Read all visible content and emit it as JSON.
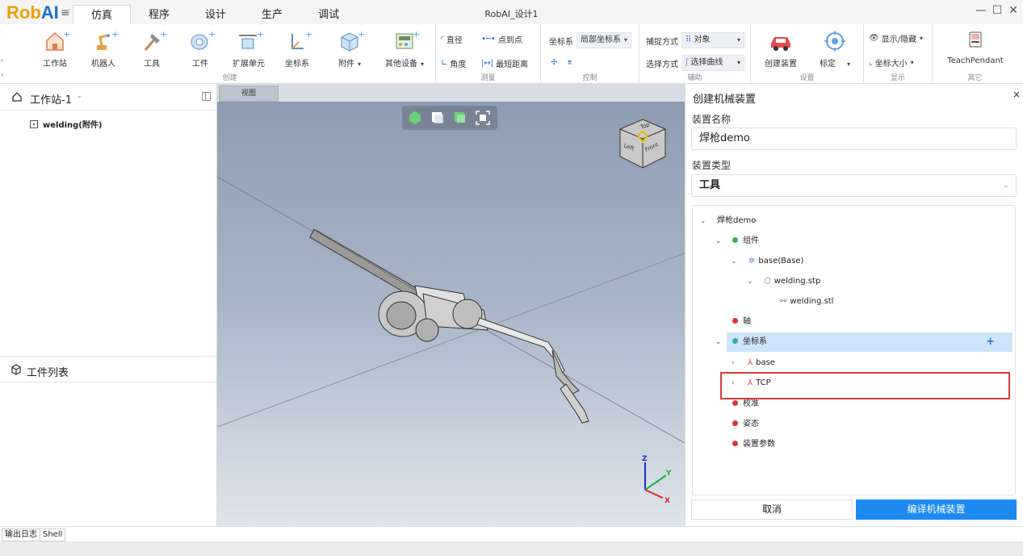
{
  "app": {
    "logo_a": "Rob",
    "logo_b": "AI",
    "window_title": "RobAI_设计1"
  },
  "tabs": [
    "仿真",
    "程序",
    "设计",
    "生产",
    "调试"
  ],
  "window_controls": {
    "minimize": "—",
    "maximize": "☐",
    "close": "✕"
  },
  "ribbon": {
    "create": {
      "label": "创建",
      "buttons": [
        "工作站",
        "机器人",
        "工具",
        "工件",
        "扩展单元",
        "坐标系",
        "附件",
        "其他设备"
      ]
    },
    "measure": {
      "label": "测量",
      "items": [
        "直径",
        "点到点",
        "角度",
        "最短距离"
      ]
    },
    "control": {
      "label": "控制",
      "coord_label": "坐标系",
      "coord_value": "局部坐标系"
    },
    "assist": {
      "label": "辅助",
      "snap_label": "捕捉方式",
      "snap_value": "对象",
      "select_label": "选择方式",
      "select_value": "选择曲线"
    },
    "settings": {
      "label": "设置",
      "buttons": [
        "创建装置",
        "标定"
      ]
    },
    "display": {
      "label": "显示",
      "show_hide": "显示/隐藏",
      "coord_size": "坐标大小"
    },
    "other": {
      "label": "其它",
      "button": "TeachPendant"
    }
  },
  "left_panel": {
    "station_title": "工作站-1",
    "tree_item": "welding(附件)",
    "workpiece_list_title": "工件列表"
  },
  "viewport": {
    "tab_label": "视图",
    "cube_labels": {
      "top": "Top",
      "left": "Left",
      "front": "Front"
    },
    "axis_labels": {
      "z": "Z",
      "y": "Y",
      "x": "X"
    }
  },
  "right_panel": {
    "title": "创建机械装置",
    "name_label": "装置名称",
    "name_value": "焊枪demo",
    "type_label": "装置类型",
    "type_value": "工具",
    "tree": {
      "root": "焊枪demo",
      "components": "组件",
      "base_component": "base(Base)",
      "stp_file": "welding.stp",
      "stl_file": "welding.stl",
      "axis": "轴",
      "coord_sys": "坐标系",
      "coord_base": "base",
      "coord_tcp": "TCP",
      "calibration": "校准",
      "pose": "姿态",
      "params": "装置参数",
      "add_symbol": "+"
    },
    "cancel_button": "取消",
    "compile_button": "编译机械装置"
  },
  "bottom_tabs": [
    "输出日志",
    "Shell"
  ],
  "colors": {
    "accent": "#1d8af0",
    "logo_orange": "#f0a000",
    "highlight_red": "#d63a3a",
    "status_green": "#2fb64c",
    "status_red": "#e0322f"
  }
}
